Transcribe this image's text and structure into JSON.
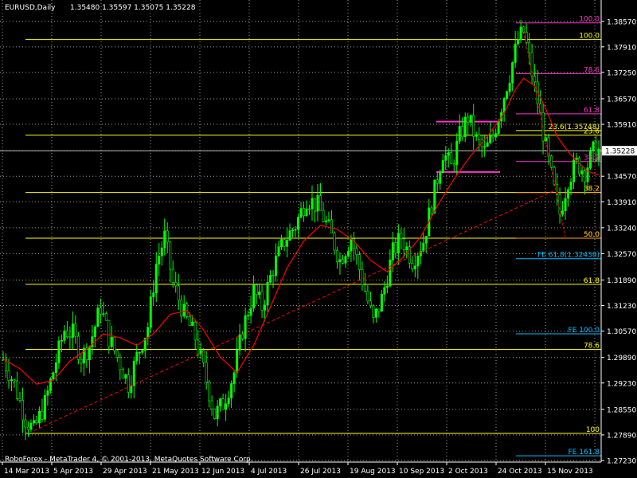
{
  "header": {
    "symbol": "EURUSD,Daily",
    "ohlc": "1.35480 1.35597 1.35075 1.35228"
  },
  "footer": {
    "copyright": "RoboForex - MetaTrader 4, © 2001-2013, MetaQuotes Software Corp."
  },
  "colors": {
    "background": "#000000",
    "grid": "#9a9a9a",
    "axis": "#ffffff",
    "candle": "#00ff00",
    "ma": "#ff0000",
    "fib_yellow": "#ffff00",
    "fib_magenta": "#ff33cc",
    "fib_orange": "#ffa500",
    "fe_cyan": "#00bfff"
  },
  "chart_data": {
    "type": "candlestick",
    "symbol": "EURUSD",
    "timeframe": "Daily",
    "ylim": [
      1.2723,
      1.3875
    ],
    "y_ticks": [
      "1.38570",
      "1.37910",
      "1.37250",
      "1.36570",
      "1.35910",
      "1.35228",
      "1.34570",
      "1.33910",
      "1.33240",
      "1.32570",
      "1.31890",
      "1.31230",
      "1.30570",
      "1.29890",
      "1.29230",
      "1.28550",
      "1.27890",
      "1.27230"
    ],
    "current_price": "1.35228",
    "x_ticks": [
      "14 Mar 2013",
      "5 Apr 2013",
      "29 Apr 2013",
      "21 May 2013",
      "12 Jun 2013",
      "4 Jul 2013",
      "26 Jul 2013",
      "19 Aug 2013",
      "10 Sep 2013",
      "2 Oct 2013",
      "24 Oct 2013",
      "15 Nov 2013"
    ],
    "close_path": [
      [
        0,
        1.2985
      ],
      [
        8,
        1.292
      ],
      [
        16,
        1.283
      ],
      [
        22,
        1.28
      ],
      [
        30,
        1.287
      ],
      [
        38,
        1.298
      ],
      [
        44,
        1.306
      ],
      [
        50,
        1.305
      ],
      [
        56,
        1.299
      ],
      [
        62,
        1.302
      ],
      [
        70,
        1.312
      ],
      [
        76,
        1.304
      ],
      [
        82,
        1.299
      ],
      [
        90,
        1.292
      ],
      [
        96,
        1.299
      ],
      [
        104,
        1.307
      ],
      [
        110,
        1.323
      ],
      [
        116,
        1.33
      ],
      [
        122,
        1.318
      ],
      [
        130,
        1.31
      ],
      [
        138,
        1.304
      ],
      [
        146,
        1.293
      ],
      [
        152,
        1.284
      ],
      [
        158,
        1.287
      ],
      [
        166,
        1.295
      ],
      [
        172,
        1.306
      ],
      [
        180,
        1.316
      ],
      [
        186,
        1.312
      ],
      [
        194,
        1.322
      ],
      [
        202,
        1.329
      ],
      [
        210,
        1.333
      ],
      [
        218,
        1.34
      ],
      [
        226,
        1.338
      ],
      [
        234,
        1.332
      ],
      [
        242,
        1.324
      ],
      [
        250,
        1.33
      ],
      [
        258,
        1.319
      ],
      [
        266,
        1.308
      ],
      [
        272,
        1.314
      ],
      [
        280,
        1.326
      ],
      [
        286,
        1.33
      ],
      [
        294,
        1.324
      ],
      [
        302,
        1.329
      ],
      [
        310,
        1.342
      ],
      [
        316,
        1.352
      ],
      [
        322,
        1.348
      ],
      [
        328,
        1.356
      ],
      [
        334,
        1.361
      ],
      [
        340,
        1.355
      ],
      [
        346,
        1.352
      ],
      [
        352,
        1.356
      ],
      [
        358,
        1.364
      ],
      [
        364,
        1.372
      ],
      [
        370,
        1.381
      ],
      [
        374,
        1.383
      ],
      [
        378,
        1.376
      ],
      [
        384,
        1.365
      ],
      [
        390,
        1.353
      ],
      [
        396,
        1.342
      ],
      [
        400,
        1.336
      ],
      [
        406,
        1.345
      ],
      [
        412,
        1.349
      ],
      [
        418,
        1.347
      ],
      [
        424,
        1.352
      ],
      [
        428,
        1.3523
      ]
    ],
    "ma_path": [
      [
        0,
        1.2985
      ],
      [
        12,
        1.296
      ],
      [
        24,
        1.292
      ],
      [
        36,
        1.293
      ],
      [
        48,
        1.298
      ],
      [
        60,
        1.301
      ],
      [
        72,
        1.305
      ],
      [
        84,
        1.304
      ],
      [
        96,
        1.302
      ],
      [
        108,
        1.305
      ],
      [
        120,
        1.31
      ],
      [
        132,
        1.311
      ],
      [
        144,
        1.306
      ],
      [
        156,
        1.299
      ],
      [
        168,
        1.295
      ],
      [
        180,
        1.302
      ],
      [
        192,
        1.312
      ],
      [
        204,
        1.322
      ],
      [
        216,
        1.329
      ],
      [
        228,
        1.333
      ],
      [
        240,
        1.332
      ],
      [
        252,
        1.329
      ],
      [
        264,
        1.324
      ],
      [
        276,
        1.321
      ],
      [
        288,
        1.325
      ],
      [
        300,
        1.33
      ],
      [
        312,
        1.338
      ],
      [
        324,
        1.345
      ],
      [
        336,
        1.351
      ],
      [
        348,
        1.356
      ],
      [
        360,
        1.362
      ],
      [
        368,
        1.368
      ],
      [
        374,
        1.371
      ],
      [
        382,
        1.369
      ],
      [
        390,
        1.363
      ],
      [
        398,
        1.356
      ],
      [
        406,
        1.352
      ],
      [
        414,
        1.349
      ],
      [
        420,
        1.347
      ],
      [
        428,
        1.346
      ]
    ],
    "trendline": {
      "from": [
        22,
        1.28
      ],
      "to": [
        396,
        1.342
      ]
    },
    "retracement_lines": [
      {
        "label": "100.0",
        "price": 1.381,
        "color": "#ffff00"
      },
      {
        "label": "23.6",
        "price": 1.3563,
        "color": "#ffff00"
      },
      {
        "label": "38.2",
        "price": 1.3415,
        "color": "#ffff00"
      },
      {
        "label": "50.0",
        "price": 1.3297,
        "color": "#ffff00"
      },
      {
        "label": "61.8",
        "price": 1.3178,
        "color": "#ffff00"
      },
      {
        "label": "78.6",
        "price": 1.301,
        "color": "#ffff00"
      },
      {
        "label": "100",
        "price": 1.2793,
        "color": "#ffff00"
      }
    ],
    "right_fib": [
      {
        "label": "100.0",
        "price": 1.3853,
        "color": "#ff33cc"
      },
      {
        "label": "78.6",
        "price": 1.3722,
        "color": "#ff33cc"
      },
      {
        "label": "61.8",
        "price": 1.3618,
        "color": "#ff33cc"
      },
      {
        "label": "23.6(1.35748)",
        "price": 1.3575,
        "color": "#ffff00"
      },
      {
        "label": "38.2",
        "price": 1.3495,
        "color": "#ff33cc"
      },
      {
        "label": "38.2",
        "price": 1.3415,
        "color": "#ffa500"
      },
      {
        "label": "50.0",
        "price": 1.3297,
        "color": "#ffa500"
      }
    ],
    "expansion_lines": [
      {
        "label": "FE 61.8(1.32438)",
        "price": 1.3244,
        "color": "#00bfff"
      },
      {
        "label": "FE 100.0",
        "price": 1.305,
        "color": "#00bfff"
      },
      {
        "label": "FE 161.8",
        "price": 1.2735,
        "color": "#00bfff"
      }
    ],
    "range_marks": [
      {
        "price": 1.3598,
        "color": "#ff33cc"
      },
      {
        "price": 1.3468,
        "color": "#ff33cc"
      }
    ]
  }
}
